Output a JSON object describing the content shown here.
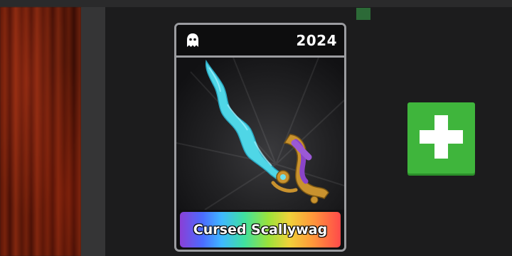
{
  "item_card": {
    "year": "2024",
    "name": "Cursed Scallywag",
    "header_icon": "ghost-icon",
    "rarity_style": "rainbow-gradient",
    "blade_color": "#4fd6e6",
    "hilt_color": "#c9922e"
  },
  "actions": {
    "add_icon": "plus-icon",
    "add_color": "#3fb53c"
  }
}
